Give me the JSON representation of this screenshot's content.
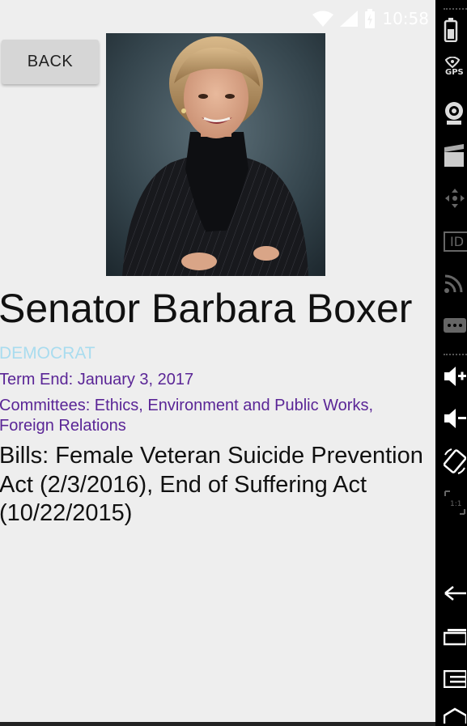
{
  "status": {
    "time": "10:58"
  },
  "back_button": {
    "label": "BACK"
  },
  "senator": {
    "name": "Senator Barbara Boxer",
    "party": "DEMOCRAT",
    "term_end": "Term End: January 3, 2017",
    "committees": "Committees: Ethics, Environment and Public Works, Foreign Relations",
    "bills": "Bills: Female Veteran Suicide Prevention Act (2/3/2016), End of Suffering Act (10/22/2015)"
  },
  "emulator_toolbar": {
    "gps_label": "GPS",
    "id_label": "ID",
    "icons": [
      "battery-icon",
      "gps-icon",
      "camera-icon",
      "video-icon",
      "dpad-icon",
      "id-icon",
      "rss-icon",
      "more-icon",
      "volume-up-icon",
      "volume-down-icon",
      "rotate-icon",
      "scale-icon",
      "back-icon",
      "home-icon",
      "menu-icon",
      "overview-icon"
    ]
  },
  "colors": {
    "party": "#a9dcef",
    "details": "#5a2596",
    "background": "#eeeeee"
  }
}
